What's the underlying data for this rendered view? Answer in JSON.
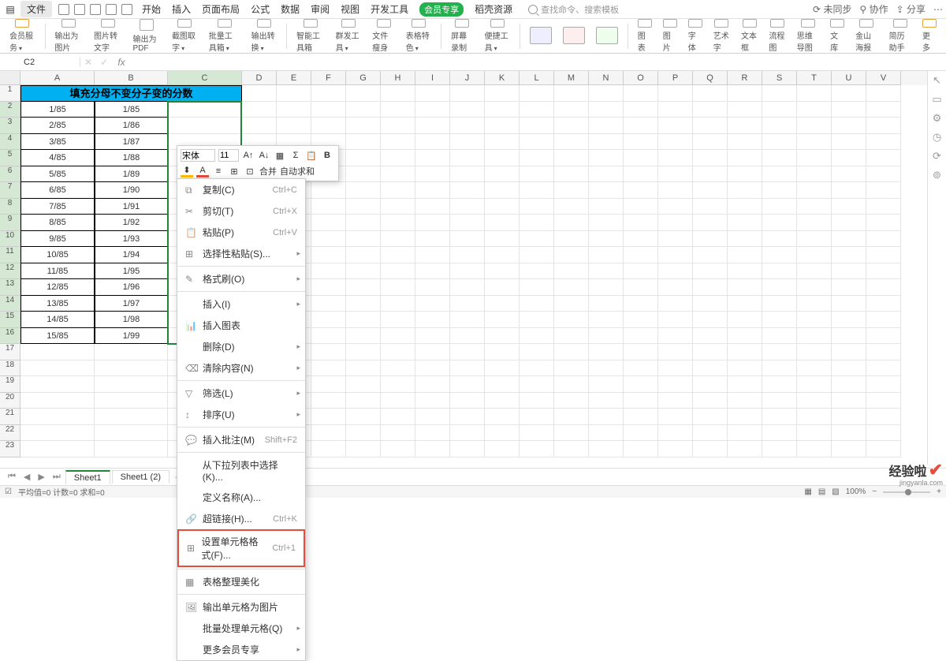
{
  "menu": {
    "file": "文件",
    "tabs": [
      "开始",
      "插入",
      "页面布局",
      "公式",
      "数据",
      "审阅",
      "视图",
      "开发工具"
    ],
    "vip": "会员专享",
    "resource": "稻壳资源",
    "search_placeholder": "查找命令、搜索模板",
    "right": [
      "未同步",
      "协作",
      "分享"
    ],
    "sync_prefix": "⟳ ",
    "collab_prefix": "⚲ ",
    "share_prefix": "⇪ "
  },
  "ribbon": [
    "会员服务",
    "输出为图片",
    "图片转文字",
    "输出为PDF",
    "截图取字",
    "批量工具箱",
    "输出转换",
    "智能工具箱",
    "群发工具",
    "文件瘦身",
    "表格特色",
    "屏幕录制",
    "便捷工具",
    "",
    "",
    "",
    "图表",
    "图片",
    "字体",
    "艺术字",
    "文本框",
    "流程图",
    "思维导图",
    "文库",
    "金山海报",
    "简历助手",
    "更多"
  ],
  "name_box": {
    "cell": "C2",
    "fx": "fx"
  },
  "columns": [
    "A",
    "B",
    "C",
    "D",
    "E",
    "F",
    "G",
    "H",
    "I",
    "J",
    "K",
    "L",
    "M",
    "N",
    "O",
    "P",
    "Q",
    "R",
    "S",
    "T",
    "U",
    "V"
  ],
  "title_cell": "填充分母不变分子变的分数",
  "data_rows": [
    {
      "n": "1"
    },
    {
      "n": "2",
      "a": "1/85",
      "b": "1/85"
    },
    {
      "n": "3",
      "a": "2/85",
      "b": "1/86"
    },
    {
      "n": "4",
      "a": "3/85",
      "b": "1/87"
    },
    {
      "n": "5",
      "a": "4/85",
      "b": "1/88"
    },
    {
      "n": "6",
      "a": "5/85",
      "b": "1/89"
    },
    {
      "n": "7",
      "a": "6/85",
      "b": "1/90"
    },
    {
      "n": "8",
      "a": "7/85",
      "b": "1/91"
    },
    {
      "n": "9",
      "a": "8/85",
      "b": "1/92"
    },
    {
      "n": "10",
      "a": "9/85",
      "b": "1/93"
    },
    {
      "n": "11",
      "a": "10/85",
      "b": "1/94"
    },
    {
      "n": "12",
      "a": "11/85",
      "b": "1/95"
    },
    {
      "n": "13",
      "a": "12/85",
      "b": "1/96"
    },
    {
      "n": "14",
      "a": "13/85",
      "b": "1/97"
    },
    {
      "n": "15",
      "a": "14/85",
      "b": "1/98"
    },
    {
      "n": "16",
      "a": "15/85",
      "b": "1/99"
    },
    {
      "n": "17"
    },
    {
      "n": "18"
    },
    {
      "n": "19"
    },
    {
      "n": "20"
    },
    {
      "n": "21"
    },
    {
      "n": "22"
    },
    {
      "n": "23"
    }
  ],
  "mini": {
    "font": "宋体",
    "size": "11",
    "merge": "合并",
    "sum": "自动求和"
  },
  "ctx": {
    "copy": "复制(C)",
    "copy_sc": "Ctrl+C",
    "cut": "剪切(T)",
    "cut_sc": "Ctrl+X",
    "paste": "粘贴(P)",
    "paste_sc": "Ctrl+V",
    "paste_special": "选择性粘贴(S)...",
    "format_painter": "格式刷(O)",
    "insert": "插入(I)",
    "insert_chart": "插入图表",
    "delete": "删除(D)",
    "clear": "清除内容(N)",
    "filter": "筛选(L)",
    "sort": "排序(U)",
    "comment": "插入批注(M)",
    "comment_sc": "Shift+F2",
    "dropdown": "从下拉列表中选择(K)...",
    "define_name": "定义名称(A)...",
    "hyperlink": "超链接(H)...",
    "hyperlink_sc": "Ctrl+K",
    "cell_format": "设置单元格格式(F)...",
    "cell_format_sc": "Ctrl+1",
    "beautify": "表格整理美化",
    "export_img": "输出单元格为图片",
    "batch": "批量处理单元格(Q)",
    "more_vip": "更多会员专享"
  },
  "tabs": {
    "s1": "Sheet1",
    "s2": "Sheet1 (2)"
  },
  "status": {
    "indicator": "☑",
    "avg": "平均值=0  计数=0  求和=0",
    "zoom": "100%"
  },
  "watermark": {
    "main": "经验啦",
    "sub": "jingyanla.com"
  }
}
